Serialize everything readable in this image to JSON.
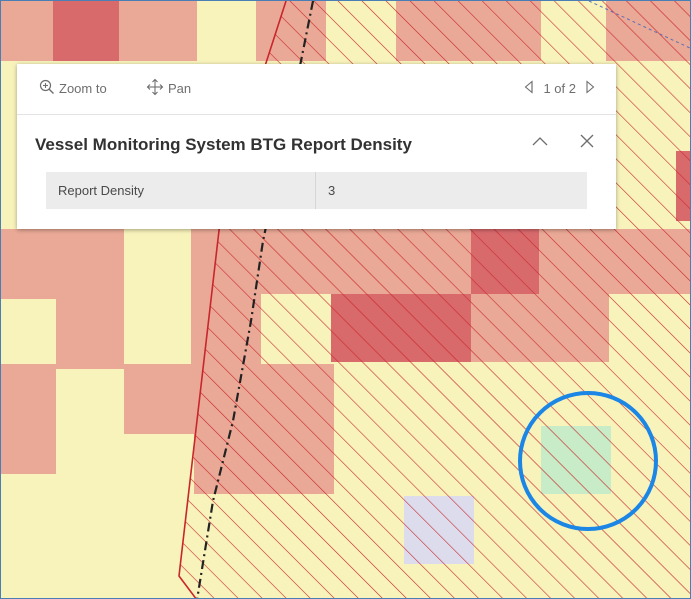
{
  "popup": {
    "zoom_label": "Zoom to",
    "pan_label": "Pan",
    "pager_text": "1 of 2",
    "title": "Vessel Monitoring System BTG Report Density",
    "fields": [
      {
        "name": "Report Density",
        "value": "3"
      }
    ]
  },
  "colors": {
    "map_background": "#f8f3bb",
    "density_low": "#eaa996",
    "density_high": "#d96a6c",
    "hatch_line": "#c8262d",
    "highlight_circle": "#1b86e5",
    "highlight_cell": "#c7ecc7",
    "lavender_cell": "#dcdcec"
  },
  "icons": [
    "zoom-in-icon",
    "pan-icon",
    "previous-icon",
    "next-icon",
    "collapse-icon",
    "close-icon"
  ]
}
